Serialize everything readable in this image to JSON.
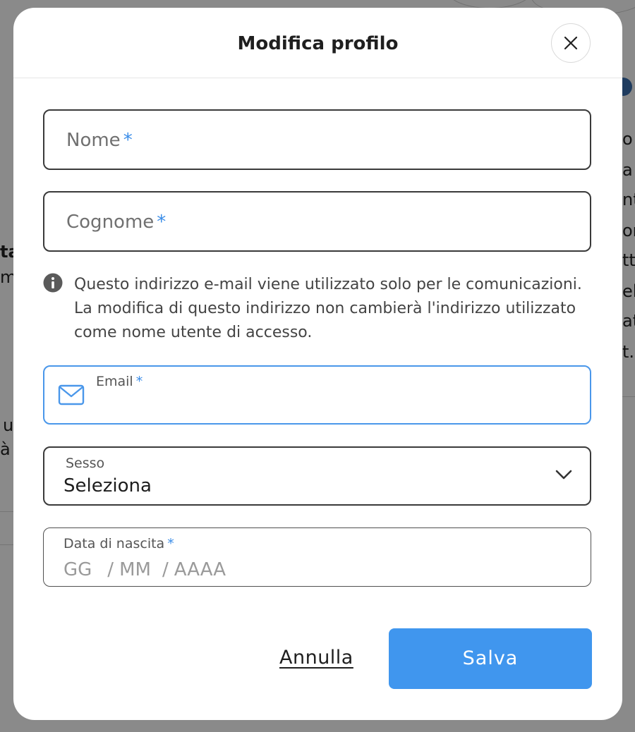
{
  "background": {
    "fragments": [
      "o",
      "a",
      "nt",
      "or",
      "tte",
      "el",
      "at",
      "t.",
      "ta",
      "m",
      "u",
      "à"
    ]
  },
  "modal": {
    "title": "Modifica profilo",
    "close_icon": "close-icon"
  },
  "form": {
    "first_name": {
      "label": "Nome",
      "required_mark": "*"
    },
    "last_name": {
      "label": "Cognome",
      "required_mark": "*"
    },
    "info_icon": "info-icon",
    "info_text": "Questo indirizzo e-mail viene utilizzato solo per le comunicazioni. La modifica di questo indirizzo non cambierà l'indirizzo utilizzato come nome utente di accesso.",
    "email": {
      "label": "Email",
      "required_mark": "*",
      "icon": "mail-icon",
      "value": ""
    },
    "gender": {
      "label": "Sesso",
      "value": "Seleziona",
      "icon": "chevron-down-icon"
    },
    "birth_date": {
      "label": "Data di nascita",
      "required_mark": "*",
      "day_placeholder": "GG",
      "month_placeholder": "MM",
      "year_placeholder": "AAAA",
      "separator": "/"
    }
  },
  "actions": {
    "cancel_label": "Annulla",
    "save_label": "Salva"
  },
  "colors": {
    "accent": "#4096ee",
    "required": "#3b8de8",
    "focus_border": "#4a97ea"
  }
}
